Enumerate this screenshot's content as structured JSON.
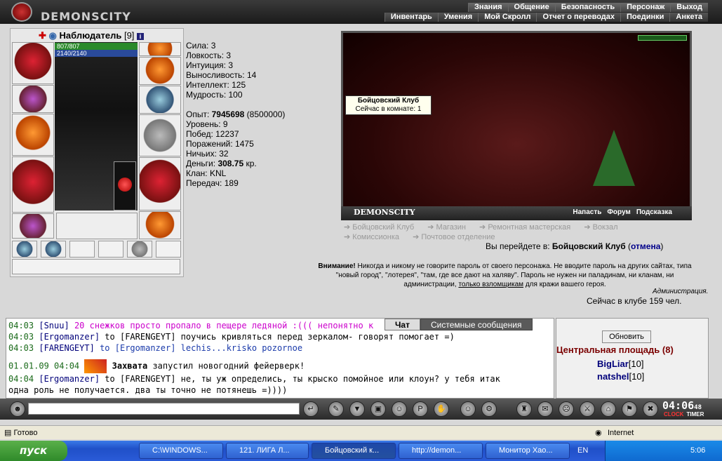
{
  "header": {
    "logo": "DEMONSCITY",
    "menu_top": [
      "Знания",
      "Общение",
      "Безопасность",
      "Персонаж",
      "Выход"
    ],
    "menu_bottom": [
      "Инвентарь",
      "Умения",
      "Мой Скролл",
      "Отчет о переводах",
      "Поединки",
      "Анкета"
    ]
  },
  "character": {
    "name": "Наблюдатель",
    "level": "[9]",
    "hp": "807/807",
    "mp": "2140/2140",
    "stats": [
      "Сила: 3",
      "Ловкость: 3",
      "Интуиция: 3",
      "Выносливость: 14",
      "Интеллект: 125",
      "Мудрость: 100"
    ],
    "exp_label": "Опыт: ",
    "exp_value": "7945698",
    "exp_next": " (8500000)",
    "info": [
      "Уровень: 9",
      "Побед: 12237",
      "Поражений: 1475",
      "Ничьих: 32"
    ],
    "money_label": "Деньги: ",
    "money_value": "308.75",
    "money_unit": " кр.",
    "clan": "Клан: KNL",
    "transfers": "Передач: 189"
  },
  "game": {
    "tooltip_title": "Бойцовский Клуб",
    "tooltip_sub": "Сейчас в комнате: 1",
    "footer_brand": "DEMONSCITY",
    "footer_links": [
      "Напасть",
      "Форум",
      "Подсказка"
    ]
  },
  "locations": [
    "Бойцовский Клуб",
    "Магазин",
    "Ремонтная мастерская",
    "Вокзал",
    "Комиссионка",
    "Почтовое отделение"
  ],
  "goto": {
    "prefix": "Вы перейдете в: ",
    "target": "Бойцовский Клуб",
    "cancel": "отмена"
  },
  "warning": {
    "bold": "Внимание!",
    "text": " Никогда и никому не говорите пароль от своего персонажа. Не вводите пароль на других сайтах, типа \"новый город\", \"лотерея\", \"там, где все дают на халяву\". Пароль не нужен ни паладинам, ни кланам, ни администрации, ",
    "link": "только взломщикам",
    "tail": " для кражи вашего героя.",
    "signature": "Администрация.",
    "online": "Сейчас в клубе 159 чел."
  },
  "chat": {
    "tabs": [
      "Чат",
      "Системные сообщения"
    ],
    "lines": [
      {
        "time": "04:03",
        "nick": "[Snuu]",
        "text": "20 снежков просто пропало в пещере ледяной :((( непонятно к",
        "color": "#cc00cc"
      },
      {
        "time": "04:03",
        "nick": "[Ergomanzer]",
        "text": "to [FARENGEYT] поучись кривляться перед зеркалом- говорят помогает =)",
        "color": "#000000"
      },
      {
        "time": "04:03",
        "nick": "[FARENGEYT]",
        "text": "to [Ergomanzer] lechis...krisko pozornoe",
        "color": "#1a3aaa"
      },
      {
        "time": "01.01.09 04:04",
        "nick": "Захвата",
        "text": "запустил новогодний фейерверк!",
        "color": "#000000"
      },
      {
        "time": "04:04",
        "nick": "[Ergomanzer]",
        "text": "to [FARENGEYT] не, ты уж определись, ты крыско помойное или клоун? у тебя итак",
        "color": "#000000"
      },
      {
        "time": "",
        "nick": "",
        "text": "одна роль не получается. два ты точно не потянешь =))))",
        "color": "#000000"
      }
    ]
  },
  "room": {
    "refresh": "Обновить",
    "title": "Центральная площадь (8)",
    "users": [
      {
        "name": "BigLiar",
        "level": "[10]"
      },
      {
        "name": "natshel",
        "level": "[10]"
      }
    ]
  },
  "clock": {
    "time": "04:06",
    "sec": "48",
    "labels": [
      "CLOCK",
      "TIMER"
    ]
  },
  "browser": {
    "status": "Готово",
    "zone": "Internet"
  },
  "taskbar": {
    "start": "пуск",
    "tasks": [
      "C:\\WINDOWS...",
      "121. ЛИГА Л...",
      "Бойцовский к...",
      "http://demon...",
      "Монитор Хао..."
    ],
    "lang": "EN",
    "time": "5:06"
  }
}
